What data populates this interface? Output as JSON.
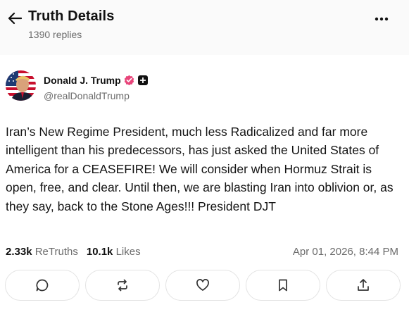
{
  "header": {
    "title": "Truth Details",
    "replies": "1390 replies"
  },
  "author": {
    "name": "Donald J. Trump",
    "handle": "@realDonaldTrump",
    "verified_color": "#e8457a"
  },
  "post": {
    "text": "Iran’s New Regime President, much less Radicalized and far more intelligent than his predecessors, has just asked the United States of America for a CEASEFIRE! We will consider when Hormuz Strait is open, free, and clear. Until then, we are blasting Iran into oblivion or, as they say, back to the Stone Ages!!! President DJT"
  },
  "stats": {
    "retruths_count": "2.33k",
    "retruths_label": "ReTruths",
    "likes_count": "10.1k",
    "likes_label": "Likes",
    "timestamp": "Apr 01, 2026, 8:44 PM"
  },
  "actions": [
    {
      "icon": "reply-icon"
    },
    {
      "icon": "retruth-icon"
    },
    {
      "icon": "like-icon"
    },
    {
      "icon": "bookmark-icon"
    },
    {
      "icon": "share-icon"
    }
  ]
}
